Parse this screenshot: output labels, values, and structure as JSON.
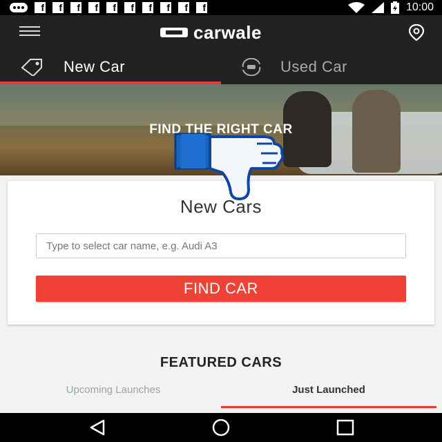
{
  "status_bar": {
    "time": "10:00",
    "notification_icons": [
      "messenger-icon",
      "facebook-icon",
      "facebook-icon",
      "facebook-icon",
      "facebook-icon",
      "facebook-icon",
      "facebook-icon",
      "facebook-icon",
      "facebook-icon",
      "facebook-icon",
      "facebook-icon"
    ],
    "system_icons": [
      "wifi-icon",
      "signal-icon",
      "battery-charging-icon"
    ]
  },
  "header": {
    "brand": "carwale",
    "menu_icon": "hamburger-icon",
    "location_icon": "location-pin-icon"
  },
  "tabs": [
    {
      "label": "New Car",
      "icon": "tag-icon",
      "active": true
    },
    {
      "label": "Used Car",
      "icon": "car-cycle-icon",
      "active": false
    }
  ],
  "banner": {
    "title": "FIND THE RIGHT CAR",
    "overlay_icon": "thumbs-down-icon"
  },
  "search_card": {
    "title": "New Cars",
    "search_placeholder": "Type to select car name, e.g. Audi A3",
    "search_value": "",
    "button_label": "FIND CAR"
  },
  "featured": {
    "title": "FEATURED CARS",
    "tabs": [
      {
        "label": "Upcoming Launches",
        "active": false
      },
      {
        "label": "Just Launched",
        "active": true
      }
    ]
  },
  "nav_bar": {
    "buttons": [
      "back-icon",
      "home-icon",
      "recents-icon"
    ]
  },
  "colors": {
    "accent": "#e53935",
    "button": "#ef4136",
    "appbar": "#222222"
  }
}
